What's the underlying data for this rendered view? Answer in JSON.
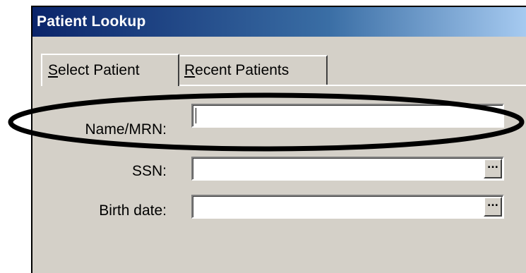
{
  "window": {
    "title": "Patient Lookup"
  },
  "tabs": [
    {
      "label_underlined": "S",
      "label_rest": "elect Patient",
      "active": true
    },
    {
      "label_underlined": "R",
      "label_rest": "ecent Patients",
      "active": false
    }
  ],
  "form": {
    "name_mrn": {
      "label": "Name/MRN:",
      "value": ""
    },
    "ssn": {
      "label": "SSN:",
      "value": "",
      "button": "..."
    },
    "birth_date": {
      "label": "Birth date:",
      "value": "",
      "button": "..."
    }
  },
  "annotation": {
    "shape": "ellipse-highlight",
    "color": "#000000",
    "target": "name_mrn"
  },
  "colors": {
    "dialog_face": "#d4d0c8",
    "titlebar_start": "#0a246a",
    "titlebar_end": "#a6caf0",
    "title_text": "#ffffff"
  }
}
